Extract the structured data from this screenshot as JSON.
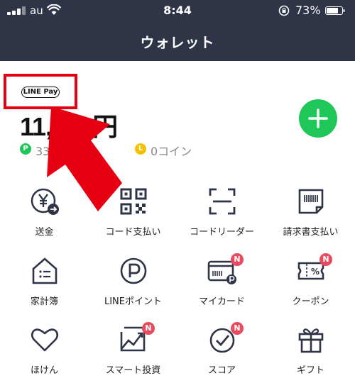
{
  "status_bar": {
    "carrier": "au",
    "time": "8:44",
    "battery": "73%"
  },
  "header": {
    "title": "ウォレット"
  },
  "wallet": {
    "badge": "LINE Pay",
    "balance": "11,190円",
    "points_text": "33 ポイント",
    "points_icon": "P",
    "coins_text": "0コイン",
    "coins_icon": "L"
  },
  "menu": {
    "items": [
      {
        "label": "送金",
        "icon": "yen-transfer-icon"
      },
      {
        "label": "コード支払い",
        "icon": "qr-code-icon"
      },
      {
        "label": "コードリーダー",
        "icon": "scan-frame-icon"
      },
      {
        "label": "請求書支払い",
        "icon": "invoice-icon"
      },
      {
        "label": "家計簿",
        "icon": "household-book-icon"
      },
      {
        "label": "LINEポイント",
        "icon": "points-icon"
      },
      {
        "label": "マイカード",
        "icon": "card-icon",
        "badge": "N"
      },
      {
        "label": "クーポン",
        "icon": "coupon-icon",
        "badge": "N"
      },
      {
        "label": "ほけん",
        "icon": "heart-icon"
      },
      {
        "label": "スマート投資",
        "icon": "investment-chart-icon",
        "badge": "N"
      },
      {
        "label": "スコア",
        "icon": "score-check-icon",
        "badge": "N"
      },
      {
        "label": "ギフト",
        "icon": "gift-icon"
      }
    ]
  },
  "colors": {
    "header_bg": "#2f3447",
    "accent_green": "#1ec757",
    "highlight_red": "#e60012",
    "badge_red": "#e84a5f"
  }
}
